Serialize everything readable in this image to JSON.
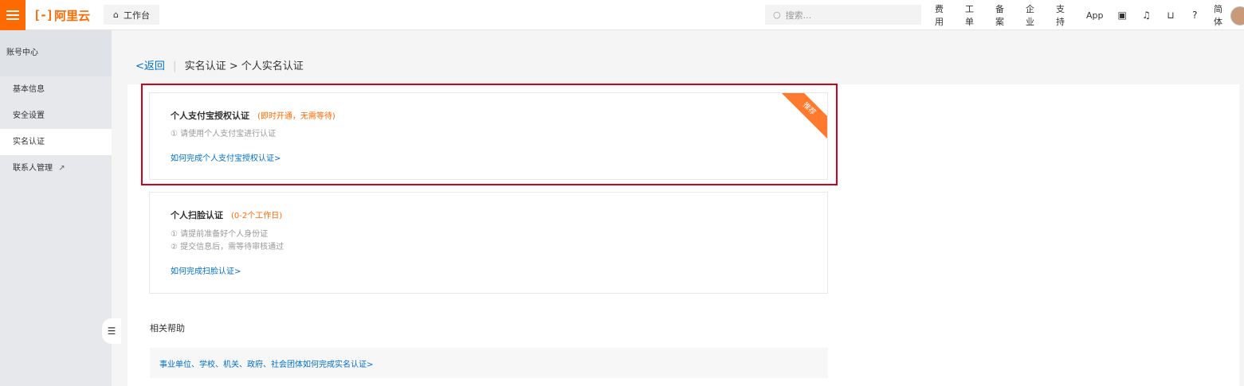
{
  "topbar": {
    "logo_text": "阿里云",
    "logo_mark": "[-]",
    "workbench_label": "工作台",
    "search_placeholder": "搜索...",
    "nav": [
      "费用",
      "工单",
      "备案",
      "企业",
      "支持",
      "App"
    ],
    "language": "简体"
  },
  "sidebar": {
    "title": "账号中心",
    "items": [
      {
        "label": "基本信息"
      },
      {
        "label": "安全设置"
      },
      {
        "label": "实名认证"
      },
      {
        "label": "联系人管理"
      }
    ]
  },
  "breadcrumb": {
    "back": "<返回",
    "separator": "|",
    "path": "实名认证 > 个人实名认证"
  },
  "cards": [
    {
      "title": "个人支付宝授权认证",
      "badge": "(即时开通，无需等待)",
      "lines": [
        "① 请使用个人支付宝进行认证"
      ],
      "link": "如何完成个人支付宝授权认证>",
      "ribbon": "推荐"
    },
    {
      "title": "个人扫脸认证",
      "badge": "(0-2个工作日)",
      "lines": [
        "① 请提前准备好个人身份证",
        "② 提交信息后，需等待审核通过"
      ],
      "link": "如何完成扫脸认证>"
    }
  ],
  "help": {
    "title": "相关帮助",
    "link": "事业单位、学校、机关、政府、社会团体如何完成实名认证>"
  },
  "colors": {
    "brand": "#ff6a00",
    "link": "#0070cc",
    "highlight_border": "#d0021b"
  }
}
